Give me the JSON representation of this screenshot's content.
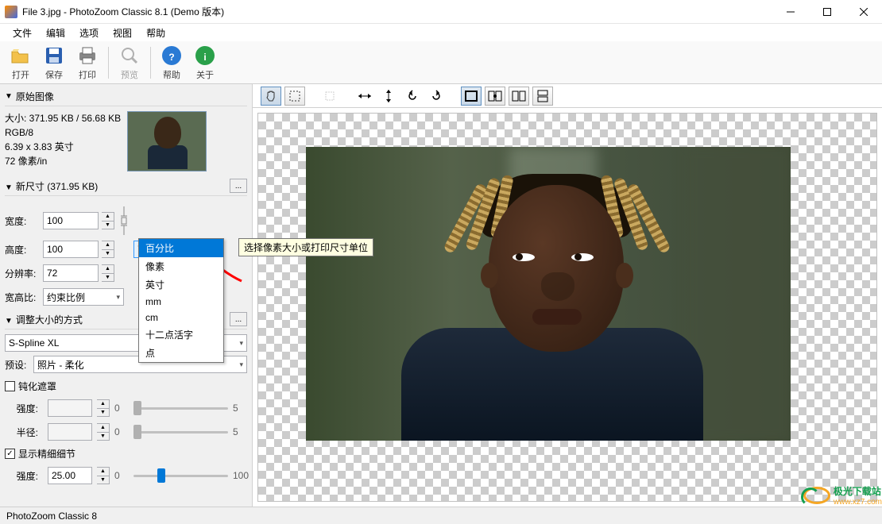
{
  "window": {
    "title": "File 3.jpg - PhotoZoom Classic 8.1 (Demo 版本)"
  },
  "menu": {
    "file": "文件",
    "edit": "编辑",
    "options": "选项",
    "view": "视图",
    "help": "帮助"
  },
  "toolbar": {
    "open": "打开",
    "save": "保存",
    "print": "打印",
    "preview": "预览",
    "help_btn": "帮助",
    "about": "关于"
  },
  "panel": {
    "original_header": "原始图像",
    "size_line": "大小: 371.95 KB / 56.68 KB",
    "mode_line": "RGB/8",
    "dim_line": "6.39 x 3.83 英寸",
    "ppi_line": "72 像素/in",
    "newsize_header": "新尺寸 (371.95 KB)",
    "width_label": "宽度:",
    "width_value": "100",
    "height_label": "高度:",
    "height_value": "100",
    "res_label": "分辨率:",
    "res_value": "72",
    "aspect_label": "宽高比:",
    "aspect_value": "约束比例",
    "unit_selected": "百分比",
    "unit_options": [
      "百分比",
      "像素",
      "英寸",
      "mm",
      "cm",
      "十二点活字",
      "点"
    ],
    "resize_header": "调整大小的方式",
    "method_value": "S-Spline XL",
    "preset_label": "预设:",
    "preset_value": "照片 - 柔化",
    "unsharp_label": "钝化遮罩",
    "strength_label": "强度:",
    "strength_value": "",
    "strength_min": "0",
    "strength_max": "5",
    "radius_label": "半径:",
    "radius_value": "",
    "radius_min": "0",
    "radius_max": "5",
    "fine_label": "显示精细细节",
    "fine_strength_label": "强度:",
    "fine_strength_value": "25.00",
    "fine_min": "0",
    "fine_max": "100"
  },
  "tooltip": {
    "unit_tip": "选择像素大小或打印尺寸单位"
  },
  "status": {
    "text": "PhotoZoom Classic 8"
  },
  "watermark": {
    "name": "极光下载站",
    "url": "www.xz7.com"
  }
}
